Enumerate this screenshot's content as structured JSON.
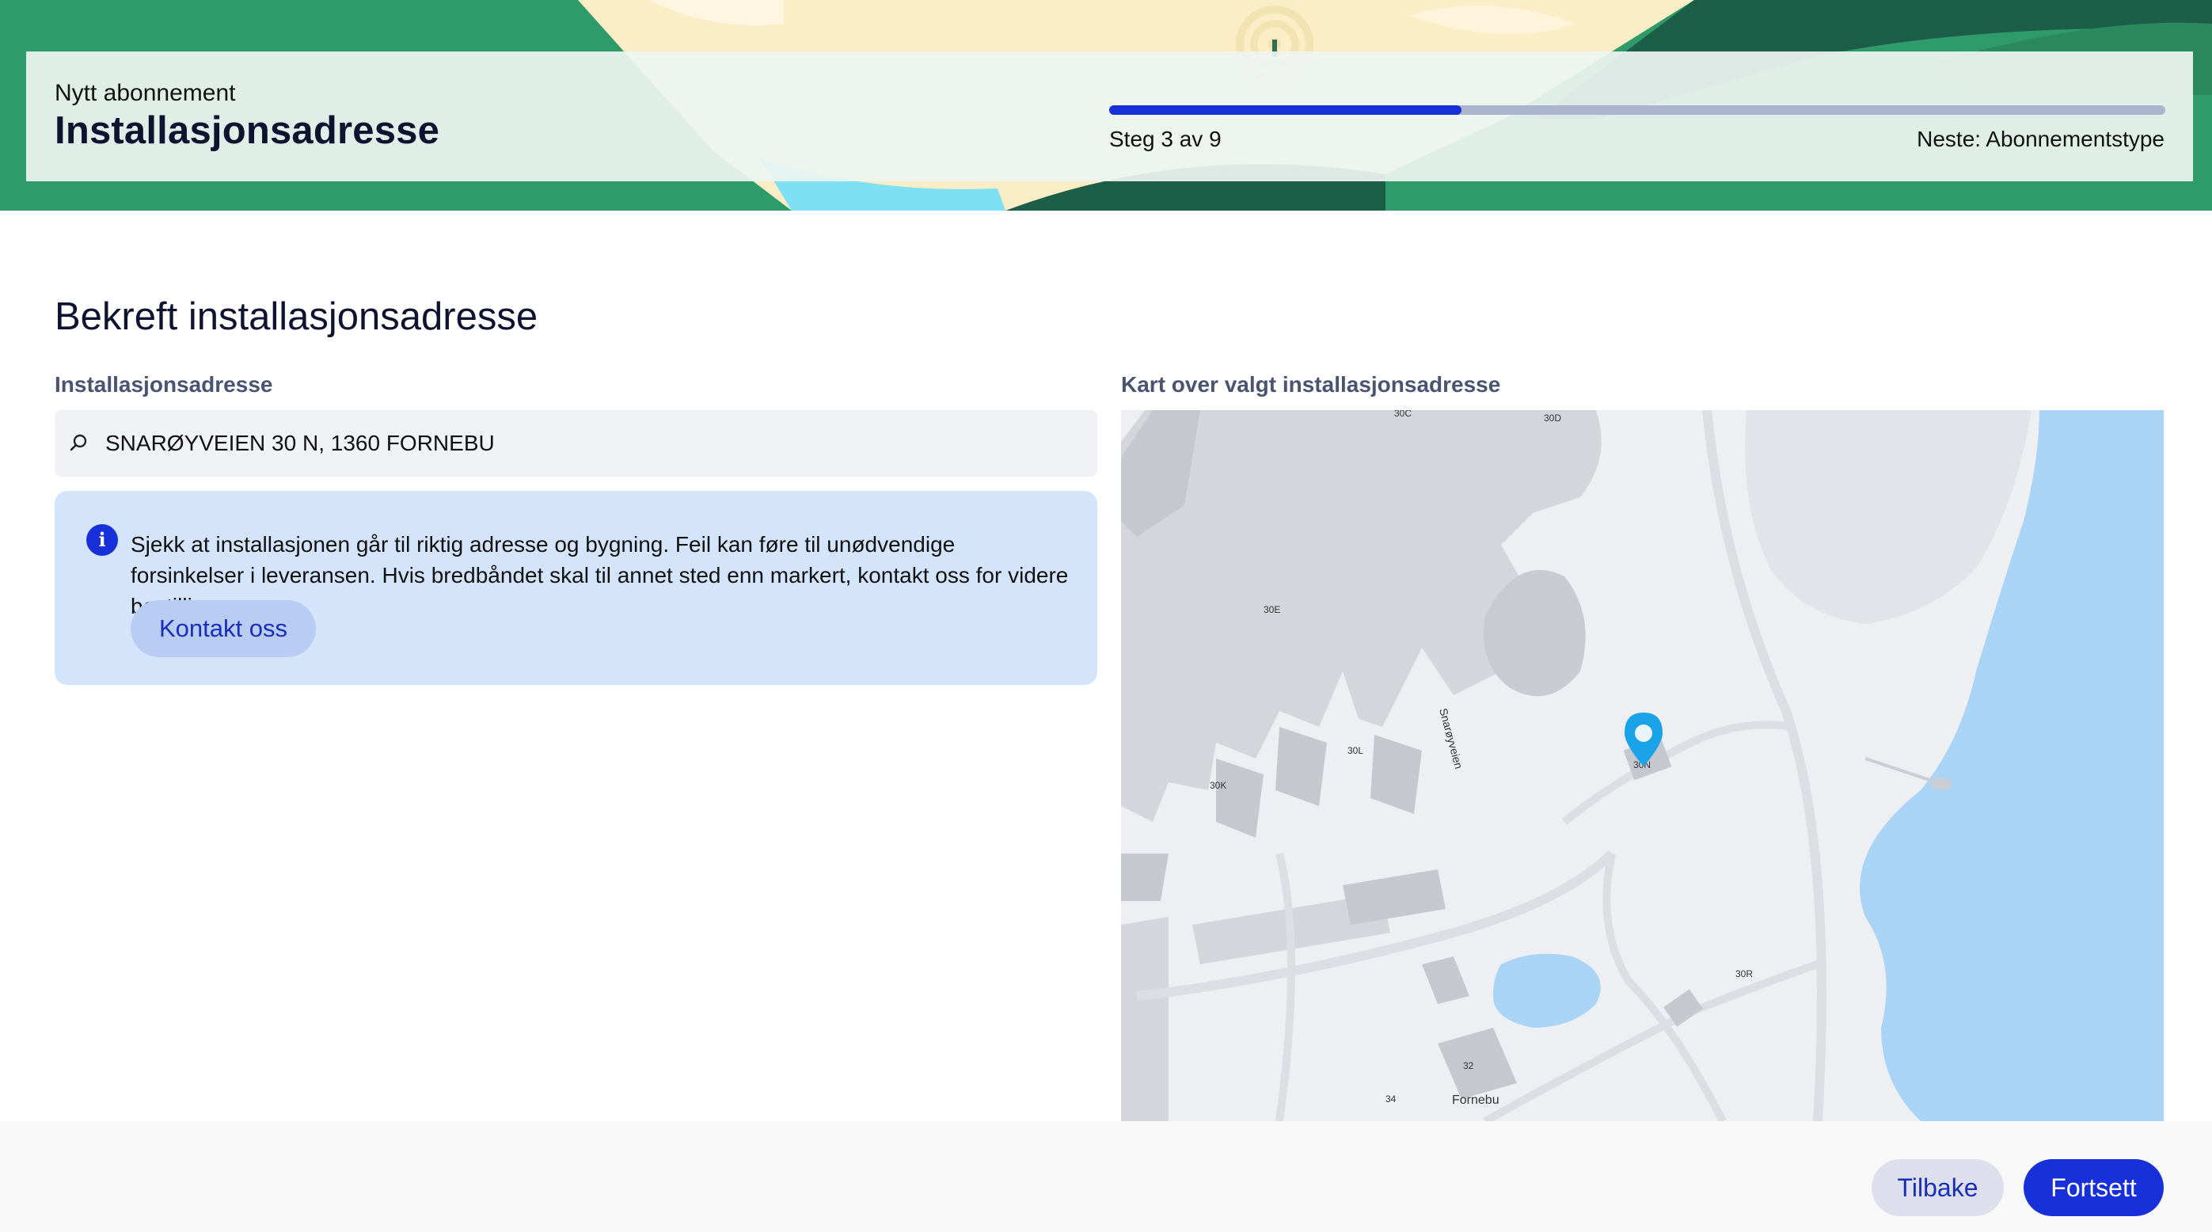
{
  "header": {
    "subtitle": "Nytt abonnement",
    "title": "Installasjonsadresse",
    "progress": {
      "step_text": "Steg 3 av 9",
      "next_text": "Neste: Abonnementstype",
      "current_step": 3,
      "total_steps": 9
    }
  },
  "main": {
    "section_title": "Bekreft installasjonsadresse",
    "address_label": "Installasjonsadresse",
    "address_value": "SNARØYVEIEN 30 N, 1360 FORNEBU",
    "info": {
      "text": "Sjekk at installasjonen går til riktig adresse og bygning. Feil kan føre til unødvendige forsinkelser i leveransen. Hvis bredbåndet skal til annet sted enn markert, kontakt oss for videre bestilling.",
      "button_label": "Kontakt oss"
    },
    "map_label": "Kart over valgt installasjonsadresse",
    "map": {
      "labels": {
        "b30c": "30C",
        "b30d": "30D",
        "b30e": "30E",
        "b30l": "30L",
        "b30k": "30K",
        "b30n": "30N",
        "b30r": "30R",
        "b32": "32",
        "b34": "34",
        "road": "Snarøyveien",
        "place": "Fornebu"
      }
    }
  },
  "footer": {
    "back_label": "Tilbake",
    "continue_label": "Fortsett"
  },
  "colors": {
    "primary": "#1730d9",
    "info_bg": "#d4e5fb",
    "map_water": "#a9d4f5",
    "map_pin": "#1aa3e8",
    "banner_green": "#2f9a6a"
  }
}
